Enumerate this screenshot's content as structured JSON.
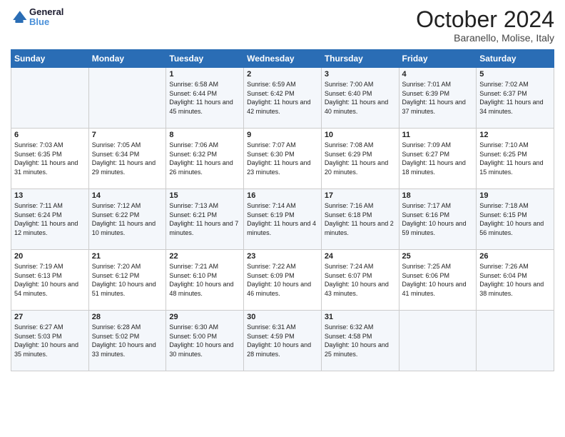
{
  "header": {
    "logo_line1": "General",
    "logo_line2": "Blue",
    "month": "October 2024",
    "location": "Baranello, Molise, Italy"
  },
  "days_of_week": [
    "Sunday",
    "Monday",
    "Tuesday",
    "Wednesday",
    "Thursday",
    "Friday",
    "Saturday"
  ],
  "weeks": [
    [
      {
        "num": "",
        "info": ""
      },
      {
        "num": "",
        "info": ""
      },
      {
        "num": "1",
        "info": "Sunrise: 6:58 AM\nSunset: 6:44 PM\nDaylight: 11 hours and 45 minutes."
      },
      {
        "num": "2",
        "info": "Sunrise: 6:59 AM\nSunset: 6:42 PM\nDaylight: 11 hours and 42 minutes."
      },
      {
        "num": "3",
        "info": "Sunrise: 7:00 AM\nSunset: 6:40 PM\nDaylight: 11 hours and 40 minutes."
      },
      {
        "num": "4",
        "info": "Sunrise: 7:01 AM\nSunset: 6:39 PM\nDaylight: 11 hours and 37 minutes."
      },
      {
        "num": "5",
        "info": "Sunrise: 7:02 AM\nSunset: 6:37 PM\nDaylight: 11 hours and 34 minutes."
      }
    ],
    [
      {
        "num": "6",
        "info": "Sunrise: 7:03 AM\nSunset: 6:35 PM\nDaylight: 11 hours and 31 minutes."
      },
      {
        "num": "7",
        "info": "Sunrise: 7:05 AM\nSunset: 6:34 PM\nDaylight: 11 hours and 29 minutes."
      },
      {
        "num": "8",
        "info": "Sunrise: 7:06 AM\nSunset: 6:32 PM\nDaylight: 11 hours and 26 minutes."
      },
      {
        "num": "9",
        "info": "Sunrise: 7:07 AM\nSunset: 6:30 PM\nDaylight: 11 hours and 23 minutes."
      },
      {
        "num": "10",
        "info": "Sunrise: 7:08 AM\nSunset: 6:29 PM\nDaylight: 11 hours and 20 minutes."
      },
      {
        "num": "11",
        "info": "Sunrise: 7:09 AM\nSunset: 6:27 PM\nDaylight: 11 hours and 18 minutes."
      },
      {
        "num": "12",
        "info": "Sunrise: 7:10 AM\nSunset: 6:25 PM\nDaylight: 11 hours and 15 minutes."
      }
    ],
    [
      {
        "num": "13",
        "info": "Sunrise: 7:11 AM\nSunset: 6:24 PM\nDaylight: 11 hours and 12 minutes."
      },
      {
        "num": "14",
        "info": "Sunrise: 7:12 AM\nSunset: 6:22 PM\nDaylight: 11 hours and 10 minutes."
      },
      {
        "num": "15",
        "info": "Sunrise: 7:13 AM\nSunset: 6:21 PM\nDaylight: 11 hours and 7 minutes."
      },
      {
        "num": "16",
        "info": "Sunrise: 7:14 AM\nSunset: 6:19 PM\nDaylight: 11 hours and 4 minutes."
      },
      {
        "num": "17",
        "info": "Sunrise: 7:16 AM\nSunset: 6:18 PM\nDaylight: 11 hours and 2 minutes."
      },
      {
        "num": "18",
        "info": "Sunrise: 7:17 AM\nSunset: 6:16 PM\nDaylight: 10 hours and 59 minutes."
      },
      {
        "num": "19",
        "info": "Sunrise: 7:18 AM\nSunset: 6:15 PM\nDaylight: 10 hours and 56 minutes."
      }
    ],
    [
      {
        "num": "20",
        "info": "Sunrise: 7:19 AM\nSunset: 6:13 PM\nDaylight: 10 hours and 54 minutes."
      },
      {
        "num": "21",
        "info": "Sunrise: 7:20 AM\nSunset: 6:12 PM\nDaylight: 10 hours and 51 minutes."
      },
      {
        "num": "22",
        "info": "Sunrise: 7:21 AM\nSunset: 6:10 PM\nDaylight: 10 hours and 48 minutes."
      },
      {
        "num": "23",
        "info": "Sunrise: 7:22 AM\nSunset: 6:09 PM\nDaylight: 10 hours and 46 minutes."
      },
      {
        "num": "24",
        "info": "Sunrise: 7:24 AM\nSunset: 6:07 PM\nDaylight: 10 hours and 43 minutes."
      },
      {
        "num": "25",
        "info": "Sunrise: 7:25 AM\nSunset: 6:06 PM\nDaylight: 10 hours and 41 minutes."
      },
      {
        "num": "26",
        "info": "Sunrise: 7:26 AM\nSunset: 6:04 PM\nDaylight: 10 hours and 38 minutes."
      }
    ],
    [
      {
        "num": "27",
        "info": "Sunrise: 6:27 AM\nSunset: 5:03 PM\nDaylight: 10 hours and 35 minutes."
      },
      {
        "num": "28",
        "info": "Sunrise: 6:28 AM\nSunset: 5:02 PM\nDaylight: 10 hours and 33 minutes."
      },
      {
        "num": "29",
        "info": "Sunrise: 6:30 AM\nSunset: 5:00 PM\nDaylight: 10 hours and 30 minutes."
      },
      {
        "num": "30",
        "info": "Sunrise: 6:31 AM\nSunset: 4:59 PM\nDaylight: 10 hours and 28 minutes."
      },
      {
        "num": "31",
        "info": "Sunrise: 6:32 AM\nSunset: 4:58 PM\nDaylight: 10 hours and 25 minutes."
      },
      {
        "num": "",
        "info": ""
      },
      {
        "num": "",
        "info": ""
      }
    ]
  ]
}
